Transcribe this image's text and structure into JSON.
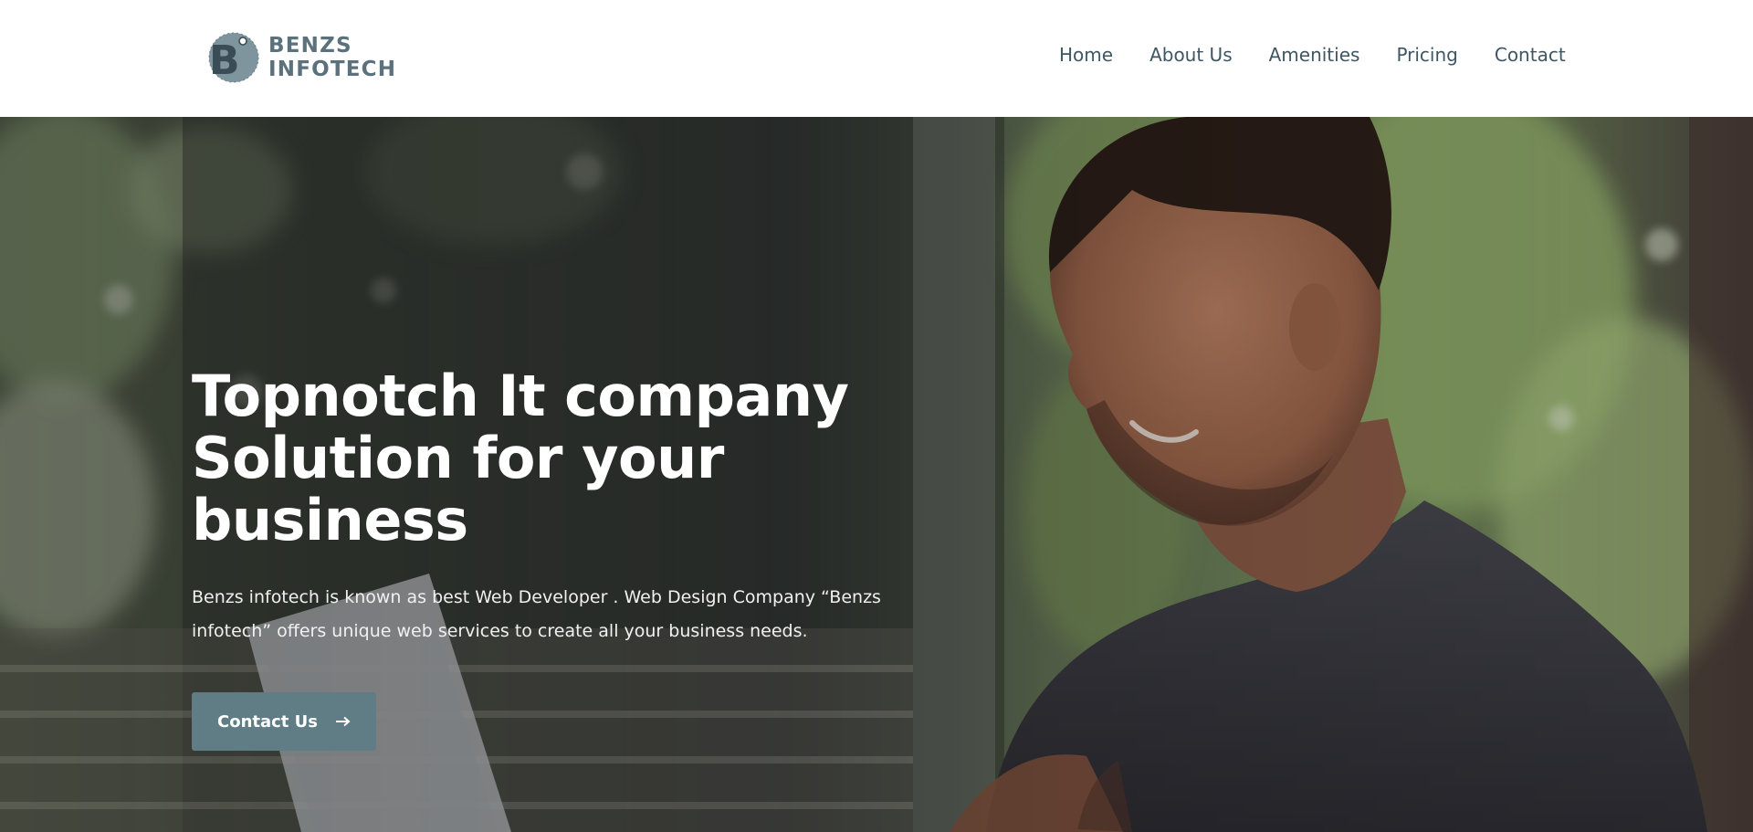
{
  "header": {
    "logo": {
      "line1": "BENZS",
      "line2": "INFOTECH",
      "mark_letter": "B"
    },
    "nav": [
      {
        "label": "Home"
      },
      {
        "label": "About Us"
      },
      {
        "label": "Amenities"
      },
      {
        "label": "Pricing"
      },
      {
        "label": "Contact"
      }
    ]
  },
  "hero": {
    "title_lines": [
      "Topnotch It company",
      "Solution for your",
      "business"
    ],
    "description": "Benzs infotech is known as best Web Developer . Web Design Company “Benzs infotech” offers unique web services to create all your business needs.",
    "cta_label": "Contact Us",
    "cta_icon": "arrow-right-icon",
    "background": "photo of smiling man working on laptop outdoors with blurred greenery"
  },
  "colors": {
    "brand": "#5b717b",
    "nav_text": "#3f5663",
    "button_bg": "#607d86",
    "hero_text": "#ffffff"
  }
}
